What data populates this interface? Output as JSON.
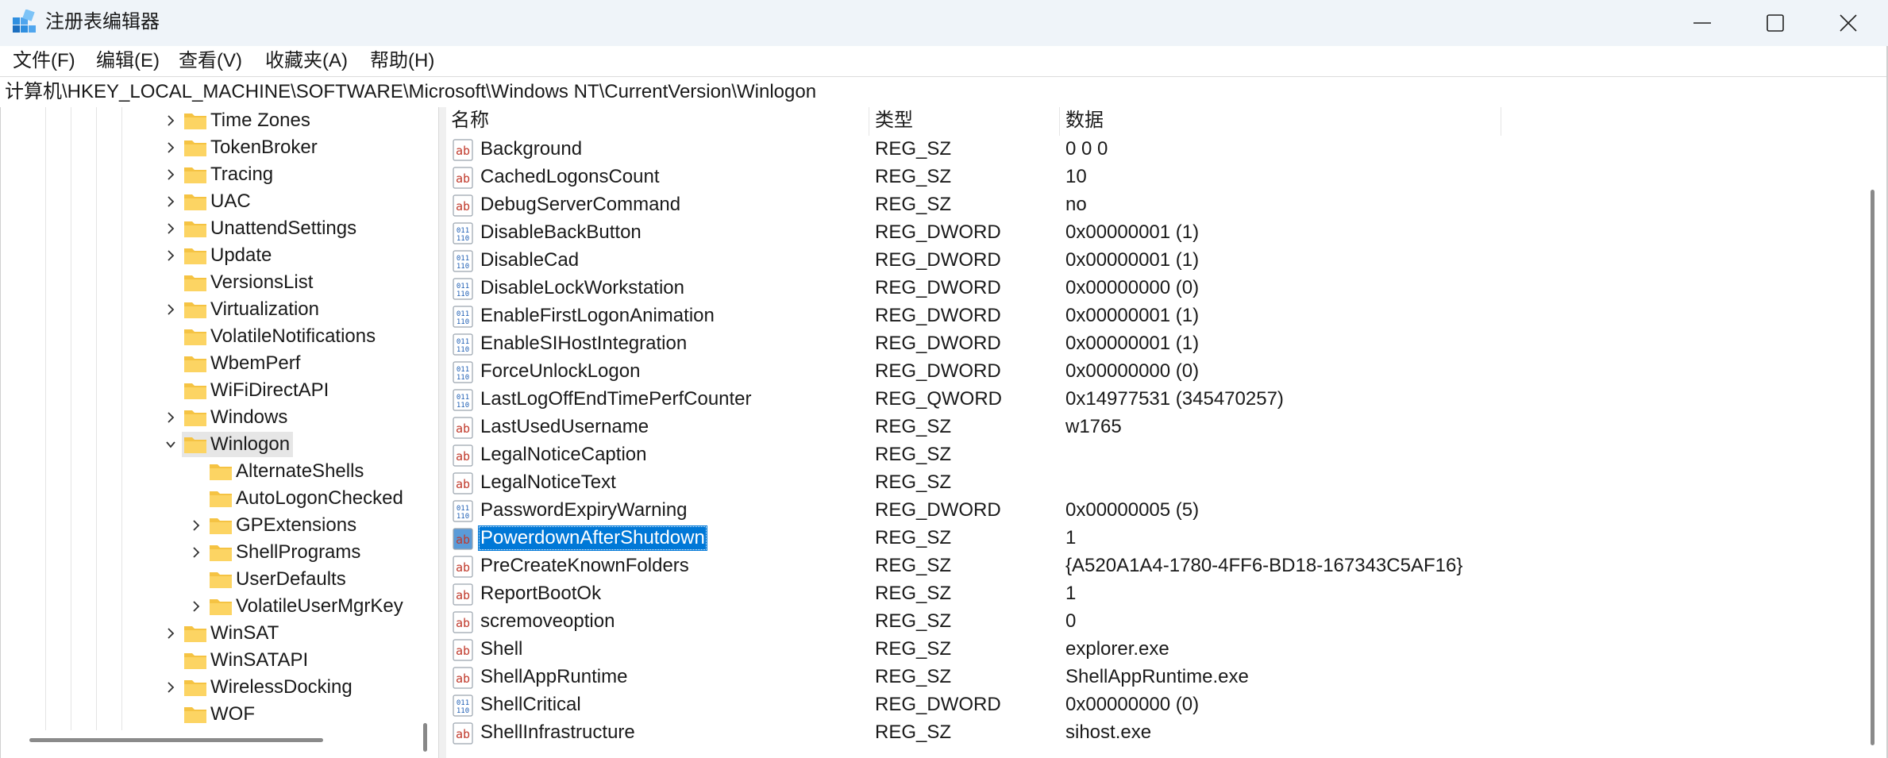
{
  "window": {
    "title": "注册表编辑器",
    "app_icon": "registry-editor-icon",
    "controls": [
      "minimize-icon",
      "maximize-icon",
      "close-icon"
    ]
  },
  "menu": [
    "文件(F)",
    "编辑(E)",
    "查看(V)",
    "收藏夹(A)",
    "帮助(H)"
  ],
  "address": "计算机\\HKEY_LOCAL_MACHINE\\SOFTWARE\\Microsoft\\Windows NT\\CurrentVersion\\Winlogon",
  "tree": [
    {
      "label": "Time Zones",
      "level": 0,
      "expander": "collapsed"
    },
    {
      "label": "TokenBroker",
      "level": 0,
      "expander": "collapsed"
    },
    {
      "label": "Tracing",
      "level": 0,
      "expander": "collapsed"
    },
    {
      "label": "UAC",
      "level": 0,
      "expander": "collapsed"
    },
    {
      "label": "UnattendSettings",
      "level": 0,
      "expander": "collapsed"
    },
    {
      "label": "Update",
      "level": 0,
      "expander": "collapsed"
    },
    {
      "label": "VersionsList",
      "level": 0,
      "expander": "none"
    },
    {
      "label": "Virtualization",
      "level": 0,
      "expander": "collapsed"
    },
    {
      "label": "VolatileNotifications",
      "level": 0,
      "expander": "none"
    },
    {
      "label": "WbemPerf",
      "level": 0,
      "expander": "none"
    },
    {
      "label": "WiFiDirectAPI",
      "level": 0,
      "expander": "none"
    },
    {
      "label": "Windows",
      "level": 0,
      "expander": "collapsed"
    },
    {
      "label": "Winlogon",
      "level": 0,
      "expander": "expanded",
      "selected": true
    },
    {
      "label": "AlternateShells",
      "level": 1,
      "expander": "none"
    },
    {
      "label": "AutoLogonChecked",
      "level": 1,
      "expander": "none"
    },
    {
      "label": "GPExtensions",
      "level": 1,
      "expander": "collapsed"
    },
    {
      "label": "ShellPrograms",
      "level": 1,
      "expander": "collapsed"
    },
    {
      "label": "UserDefaults",
      "level": 1,
      "expander": "none"
    },
    {
      "label": "VolatileUserMgrKey",
      "level": 1,
      "expander": "collapsed"
    },
    {
      "label": "WinSAT",
      "level": 0,
      "expander": "collapsed"
    },
    {
      "label": "WinSATAPI",
      "level": 0,
      "expander": "none"
    },
    {
      "label": "WirelessDocking",
      "level": 0,
      "expander": "collapsed"
    },
    {
      "label": "WOF",
      "level": 0,
      "expander": "none"
    }
  ],
  "columns": {
    "name": "名称",
    "type": "类型",
    "data": "数据"
  },
  "values": [
    {
      "name": "Background",
      "type": "REG_SZ",
      "data": "0 0 0",
      "icon": "string-value-icon"
    },
    {
      "name": "CachedLogonsCount",
      "type": "REG_SZ",
      "data": "10",
      "icon": "string-value-icon"
    },
    {
      "name": "DebugServerCommand",
      "type": "REG_SZ",
      "data": "no",
      "icon": "string-value-icon"
    },
    {
      "name": "DisableBackButton",
      "type": "REG_DWORD",
      "data": "0x00000001 (1)",
      "icon": "binary-value-icon"
    },
    {
      "name": "DisableCad",
      "type": "REG_DWORD",
      "data": "0x00000001 (1)",
      "icon": "binary-value-icon"
    },
    {
      "name": "DisableLockWorkstation",
      "type": "REG_DWORD",
      "data": "0x00000000 (0)",
      "icon": "binary-value-icon"
    },
    {
      "name": "EnableFirstLogonAnimation",
      "type": "REG_DWORD",
      "data": "0x00000001 (1)",
      "icon": "binary-value-icon"
    },
    {
      "name": "EnableSIHostIntegration",
      "type": "REG_DWORD",
      "data": "0x00000001 (1)",
      "icon": "binary-value-icon"
    },
    {
      "name": "ForceUnlockLogon",
      "type": "REG_DWORD",
      "data": "0x00000000 (0)",
      "icon": "binary-value-icon"
    },
    {
      "name": "LastLogOffEndTimePerfCounter",
      "type": "REG_QWORD",
      "data": "0x14977531 (345470257)",
      "icon": "binary-value-icon"
    },
    {
      "name": "LastUsedUsername",
      "type": "REG_SZ",
      "data": "w1765",
      "icon": "string-value-icon"
    },
    {
      "name": "LegalNoticeCaption",
      "type": "REG_SZ",
      "data": "",
      "icon": "string-value-icon"
    },
    {
      "name": "LegalNoticeText",
      "type": "REG_SZ",
      "data": "",
      "icon": "string-value-icon"
    },
    {
      "name": "PasswordExpiryWarning",
      "type": "REG_DWORD",
      "data": "0x00000005 (5)",
      "icon": "binary-value-icon"
    },
    {
      "name": "PowerdownAfterShutdown",
      "type": "REG_SZ",
      "data": "1",
      "icon": "string-value-icon",
      "selected": true
    },
    {
      "name": "PreCreateKnownFolders",
      "type": "REG_SZ",
      "data": "{A520A1A4-1780-4FF6-BD18-167343C5AF16}",
      "icon": "string-value-icon"
    },
    {
      "name": "ReportBootOk",
      "type": "REG_SZ",
      "data": "1",
      "icon": "string-value-icon"
    },
    {
      "name": "scremoveoption",
      "type": "REG_SZ",
      "data": "0",
      "icon": "string-value-icon"
    },
    {
      "name": "Shell",
      "type": "REG_SZ",
      "data": "explorer.exe",
      "icon": "string-value-icon"
    },
    {
      "name": "ShellAppRuntime",
      "type": "REG_SZ",
      "data": "ShellAppRuntime.exe",
      "icon": "string-value-icon"
    },
    {
      "name": "ShellCritical",
      "type": "REG_DWORD",
      "data": "0x00000000 (0)",
      "icon": "binary-value-icon"
    },
    {
      "name": "ShellInfrastructure",
      "type": "REG_SZ",
      "data": "sihost.exe",
      "icon": "string-value-icon"
    }
  ],
  "colors": {
    "titlebar": "#eff4f9",
    "selection": "#0078d7",
    "tree_selection": "#e6e6e6",
    "folder": "#f5c343",
    "string_icon": "#c0392b",
    "binary_icon": "#1f5fb4"
  }
}
